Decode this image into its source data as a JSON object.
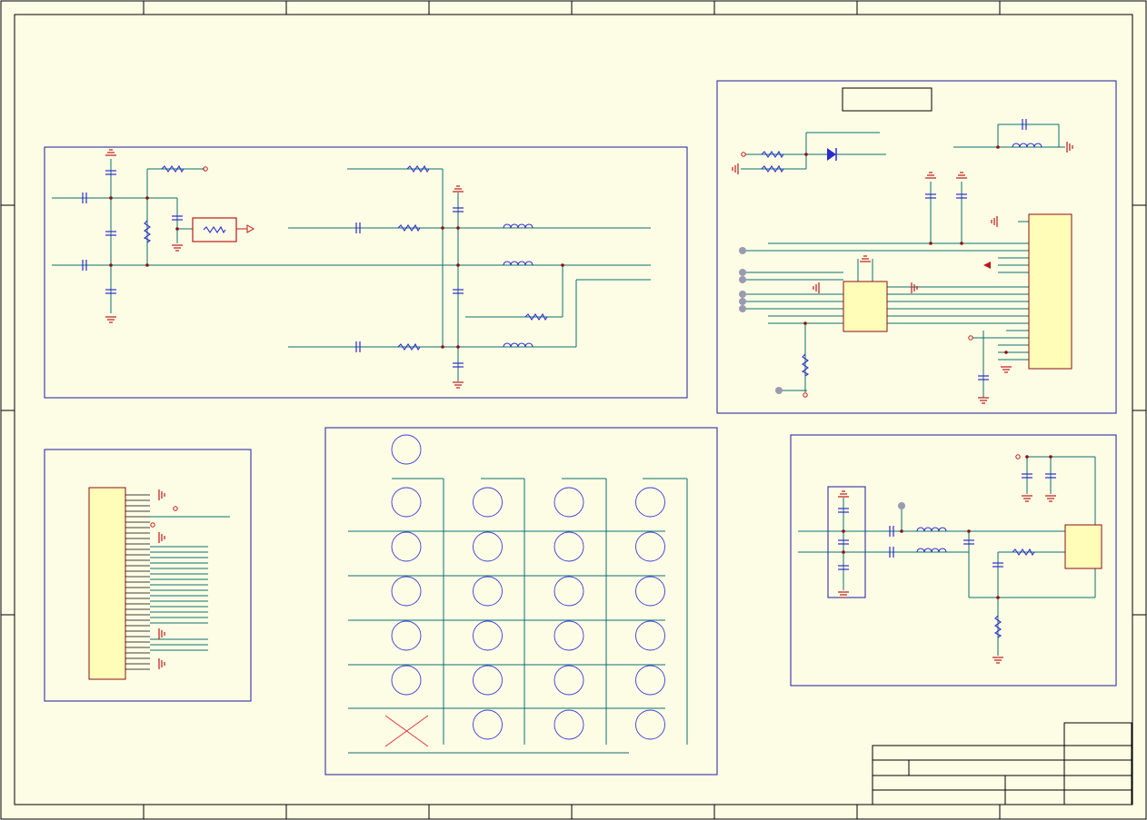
{
  "document": {
    "type": "schematic-sheet"
  },
  "colors": {
    "sheet_background": "#fdfde6",
    "frame": "#000000",
    "block_border": "#1a1aa0",
    "wire": "#0a6e6e",
    "component": "#2b2bd0",
    "power_symbol": "#c01818",
    "io_port": "#c01818",
    "ic_fill": "#fffdb8",
    "ic_border": "#8b1010",
    "testpoint": "#9a9ab0",
    "pad": "#3b3bd8",
    "dnp_mark": "#e03030"
  },
  "blocks": [
    {
      "name": "rf-frontend-block"
    },
    {
      "name": "power-supply-block"
    },
    {
      "name": "connector-block"
    },
    {
      "name": "pad-array-block"
    },
    {
      "name": "amplifier-block"
    }
  ],
  "pad_array": {
    "rows": 6,
    "columns": 4
  },
  "title_block": {
    "present": true
  }
}
